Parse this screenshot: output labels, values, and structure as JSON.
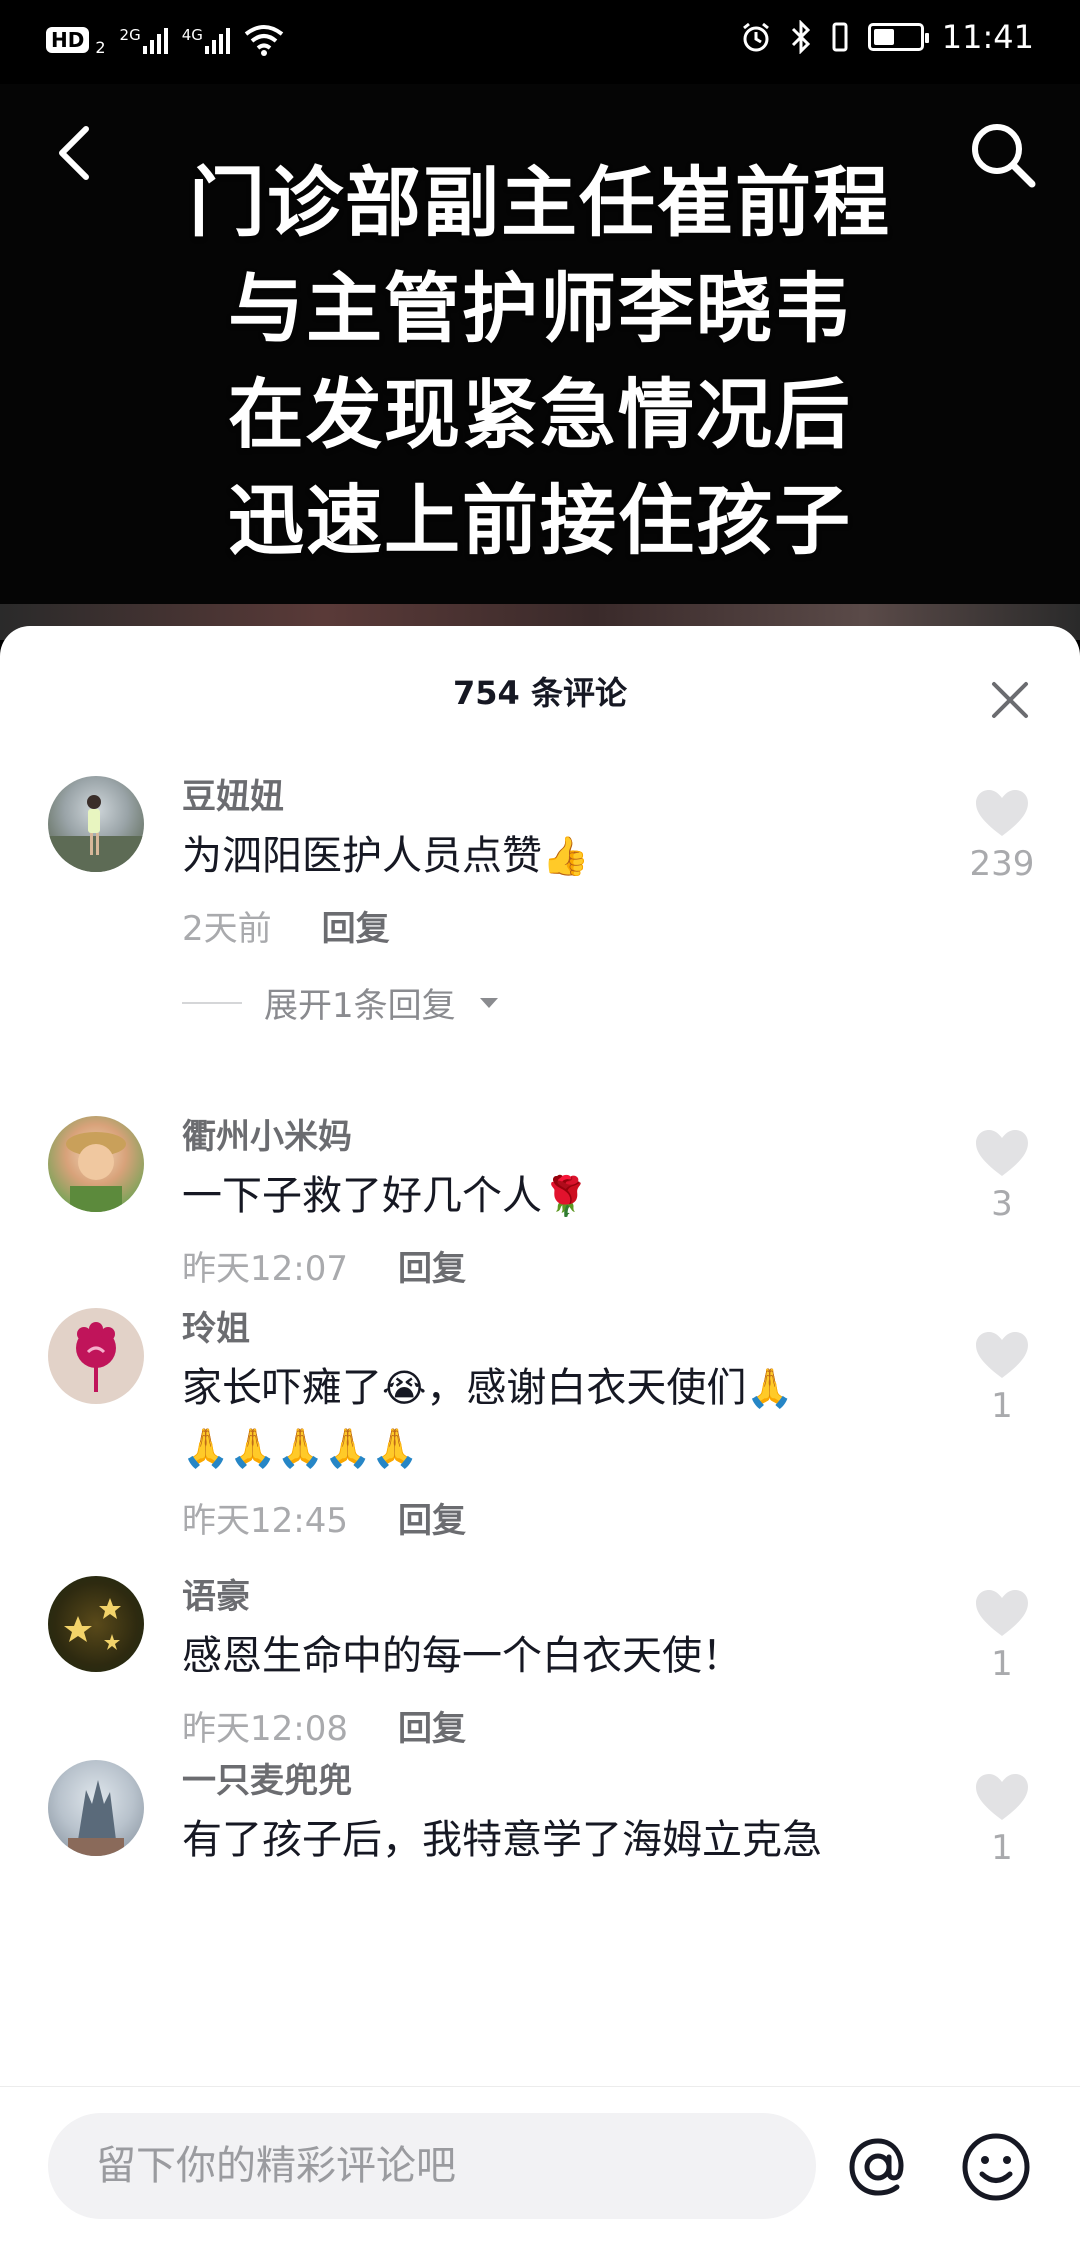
{
  "status_bar": {
    "hd": "HD",
    "hd_sub": "2",
    "net1": "2G",
    "net2": "4G",
    "time": "11:41",
    "battery_level": 0.45
  },
  "video": {
    "caption_lines": [
      "门诊部副主任崔前程",
      "与主管护师李晓韦",
      "在发现紧急情况后",
      "迅速上前接住孩子"
    ]
  },
  "sheet": {
    "title": "754 条评论"
  },
  "comments": [
    {
      "username": "豆妞妞",
      "text": "为泗阳医护人员点赞",
      "emoji": "👍",
      "time": "2天前",
      "reply": "回复",
      "likes": "239",
      "expand": "展开1条回复"
    },
    {
      "username": "衢州小米妈",
      "text": "一下子救了好几个人",
      "emoji": "🌹",
      "time": "昨天12:07",
      "reply": "回复",
      "likes": "3"
    },
    {
      "username": "玲姐",
      "text_a": "家长吓瘫了",
      "emoji_a": "😭",
      "text_b": "，感谢白衣天使们",
      "emoji_b": "🙏",
      "emoji_line": "🙏🙏🙏🙏🙏",
      "time": "昨天12:45",
      "reply": "回复",
      "likes": "1"
    },
    {
      "username": "语豪",
      "text": "感恩生命中的每一个白衣天使！",
      "time": "昨天12:08",
      "reply": "回复",
      "likes": "1"
    },
    {
      "username": "一只麦兜兜",
      "text": "有了孩子后，我特意学了海姆立克急",
      "likes": "1"
    }
  ],
  "input": {
    "placeholder": "留下你的精彩评论吧"
  },
  "icons": {
    "back": "chevron-left-icon",
    "search": "search-icon",
    "close": "close-icon",
    "like": "heart-icon",
    "at": "at-icon",
    "emoji": "smiley-icon"
  },
  "colors": {
    "like_heart": "#e2e2e4",
    "text_primary": "#161823",
    "text_secondary": "#a9aaad"
  }
}
